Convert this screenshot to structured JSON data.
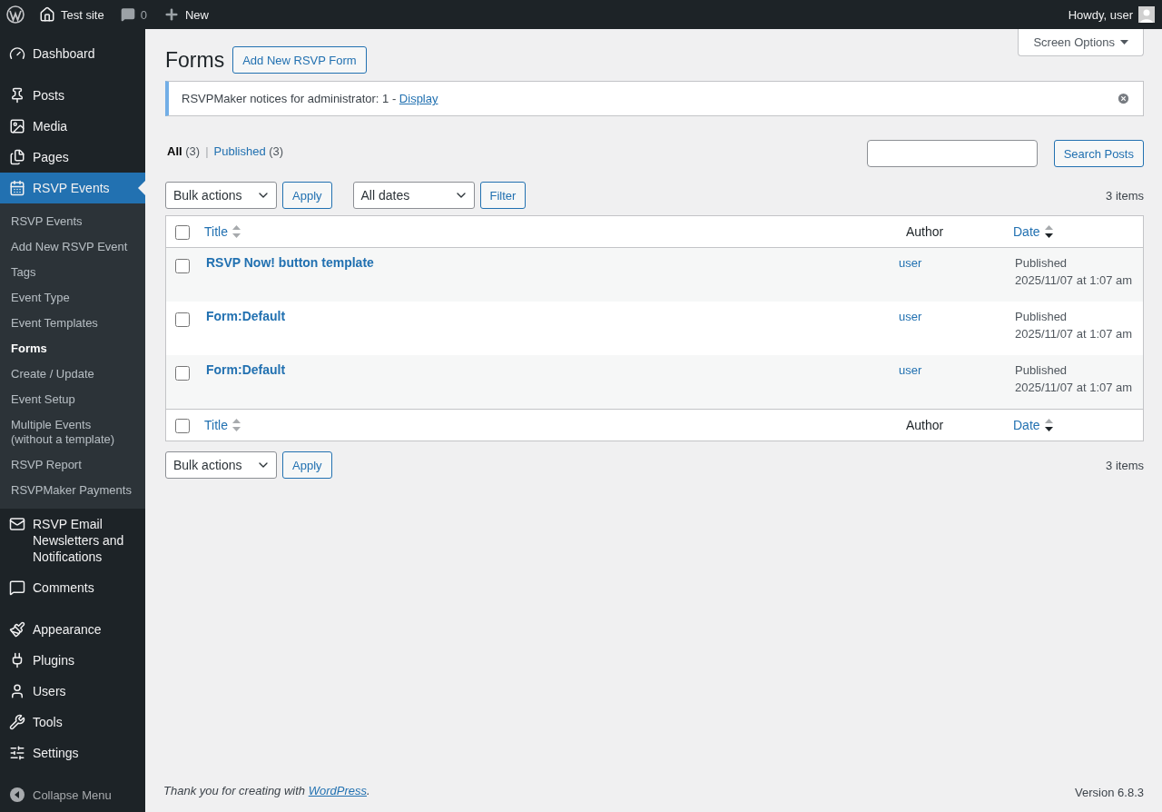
{
  "admin_bar": {
    "site": "Test site",
    "comments": "0",
    "new": "New",
    "greeting": "Howdy, user"
  },
  "sidebar": {
    "groups": [
      [
        {
          "label": "Dashboard",
          "selected": false
        }
      ],
      [
        {
          "label": "Posts",
          "selected": false
        },
        {
          "label": "Media",
          "selected": false
        },
        {
          "label": "Pages",
          "selected": false
        },
        {
          "label": "RSVP Events",
          "selected": true,
          "children": [
            {
              "label": "RSVP Events",
              "selected": false
            },
            {
              "label": "Add New RSVP Event",
              "selected": false
            },
            {
              "label": "Tags",
              "selected": false
            },
            {
              "label": "Event Type",
              "selected": false
            },
            {
              "label": "Event Templates",
              "selected": false
            },
            {
              "label": "Forms",
              "selected": true
            },
            {
              "label": "Create / Update",
              "selected": false
            },
            {
              "label": "Event Setup",
              "selected": false
            },
            {
              "label": "Multiple Events (without a template)",
              "selected": false
            },
            {
              "label": "RSVP Report",
              "selected": false
            },
            {
              "label": "RSVPMaker Payments",
              "selected": false
            }
          ]
        },
        {
          "label": "RSVP Email Newsletters and Notifications",
          "selected": false
        },
        {
          "label": "Comments",
          "selected": false
        }
      ],
      [
        {
          "label": "Appearance",
          "selected": false
        },
        {
          "label": "Plugins",
          "selected": false
        },
        {
          "label": "Users",
          "selected": false
        },
        {
          "label": "Tools",
          "selected": false
        },
        {
          "label": "Settings",
          "selected": false
        }
      ]
    ],
    "collapse": "Collapse Menu"
  },
  "page": {
    "title": "Forms",
    "add_button": "Add New RSVP Form",
    "screen_options": "Screen Options"
  },
  "notice": {
    "text": "RSVPMaker notices for administrator: 1 - ",
    "link": "Display"
  },
  "views": {
    "separator": "|",
    "items": [
      {
        "label": "All",
        "count": "(3)",
        "selected": true
      },
      {
        "label": "Published",
        "count": "(3)",
        "selected": false
      }
    ]
  },
  "search": {
    "button": "Search Posts"
  },
  "top_nav": {
    "bulk": "Bulk actions",
    "apply": "Apply",
    "dates": "All dates",
    "filter": "Filter",
    "count": "3 items"
  },
  "table": {
    "select_all_checked": false,
    "columns": [
      {
        "label": "Title",
        "sortable": true,
        "sorted": false
      },
      {
        "label": "Author",
        "sortable": false
      },
      {
        "label": "Date",
        "sortable": true,
        "sorted": true
      }
    ],
    "rows": [
      {
        "checked": false,
        "title": "RSVP Now! button template",
        "author": "user",
        "status": "Published",
        "date": "2025/11/07 at 1:07 am"
      },
      {
        "checked": false,
        "title": "Form:Default",
        "author": "user",
        "status": "Published",
        "date": "2025/11/07 at 1:07 am"
      },
      {
        "checked": false,
        "title": "Form:Default",
        "author": "user",
        "status": "Published",
        "date": "2025/11/07 at 1:07 am"
      }
    ],
    "footer_select_all_checked": false,
    "footer_columns": [
      {
        "label": "Title",
        "sortable": true,
        "sorted": false
      },
      {
        "label": "Author",
        "sortable": false
      },
      {
        "label": "Date",
        "sortable": true,
        "sorted": true
      }
    ]
  },
  "bottom_nav": {
    "bulk": "Bulk actions",
    "apply": "Apply",
    "count": "3 items"
  },
  "footer": {
    "text": "Thank you for creating with ",
    "link": "WordPress",
    "after": ".",
    "version": "Version 6.8.3"
  }
}
